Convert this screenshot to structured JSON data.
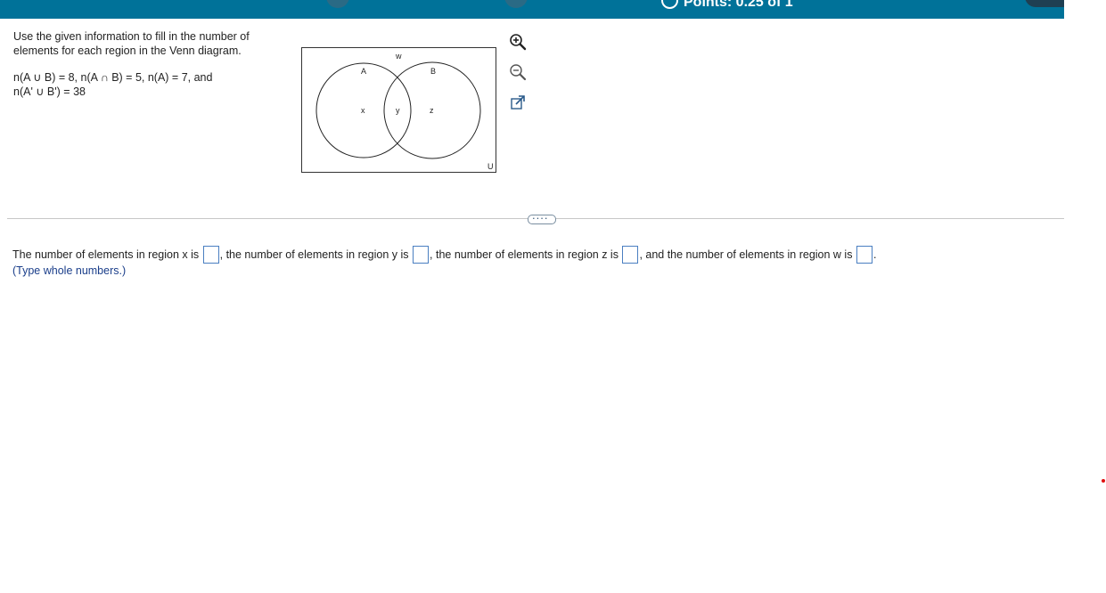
{
  "header": {
    "points_text": "Points: 0.25 of 1"
  },
  "problem": {
    "instruction": "Use the given information to fill in the number of elements for each region in the Venn diagram.",
    "given_line1": "n(A ∪ B) = 8, n(A ∩ B) = 5, n(A) = 7, and",
    "given_line2": "n(A' ∪ B') = 38"
  },
  "venn": {
    "label_w": "w",
    "label_A": "A",
    "label_B": "B",
    "label_x": "x",
    "label_y": "y",
    "label_z": "z",
    "label_U": "U"
  },
  "tools": [
    "zoom-in-icon",
    "zoom-out-icon",
    "popout-icon"
  ],
  "more_button": "....",
  "answer": {
    "part1": "The number of elements in region x is",
    "part2": ", the number of elements in region y is",
    "part3": ", the number of elements in region z is",
    "part4": ", and the number of elements in region w is",
    "end": ".",
    "x_value": "",
    "y_value": "",
    "z_value": "",
    "w_value": "",
    "hint": "(Type whole numbers.)"
  },
  "colors": {
    "topbar": "#007299",
    "input_border": "#4a7fc1",
    "hint": "#1a3e8a"
  }
}
